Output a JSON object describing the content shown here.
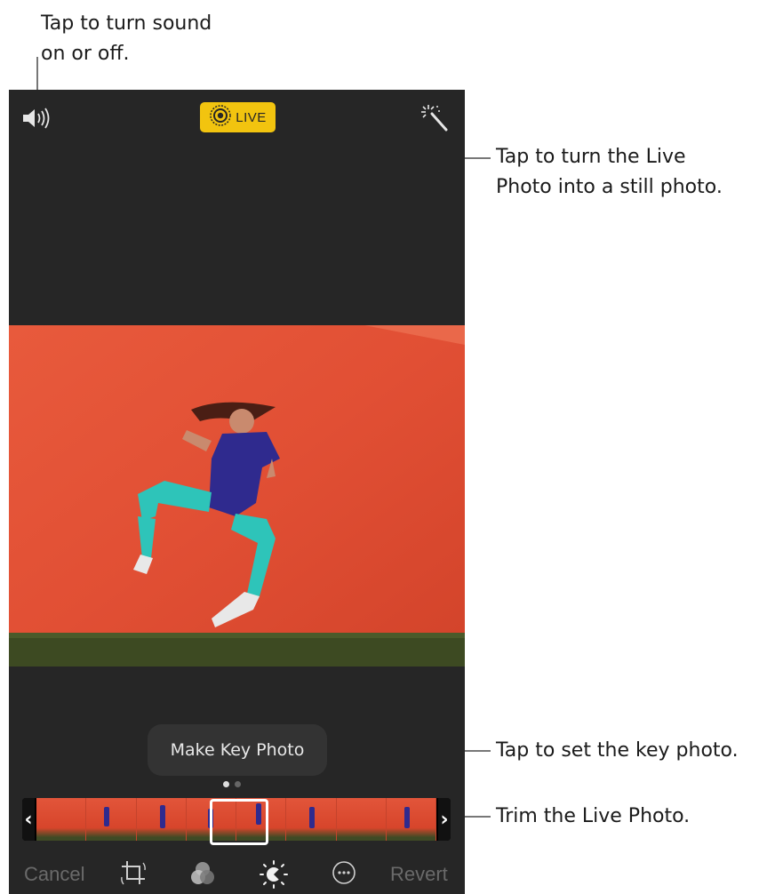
{
  "callouts": {
    "sound_line1": "Tap to turn sound",
    "sound_line2": "on or off.",
    "live_line1": "Tap to turn the Live",
    "live_line2": "Photo into a still photo.",
    "key_photo": "Tap to set the key photo.",
    "trim": "Trim the Live Photo."
  },
  "editor": {
    "live_badge_label": "LIVE",
    "live_badge_color": "#f2c40f",
    "key_photo_tooltip": "Make Key Photo",
    "toolbar": {
      "cancel_label": "Cancel",
      "revert_label": "Revert",
      "icons": [
        "crop-icon",
        "filters-icon",
        "adjust-icon",
        "more-icon"
      ]
    },
    "top_icons": [
      "speaker-icon",
      "live-icon",
      "auto-enhance-icon"
    ],
    "photo_description_colors": {
      "wall": "#e2553a",
      "grass": "#3d4a22"
    },
    "frame_count": 8
  }
}
